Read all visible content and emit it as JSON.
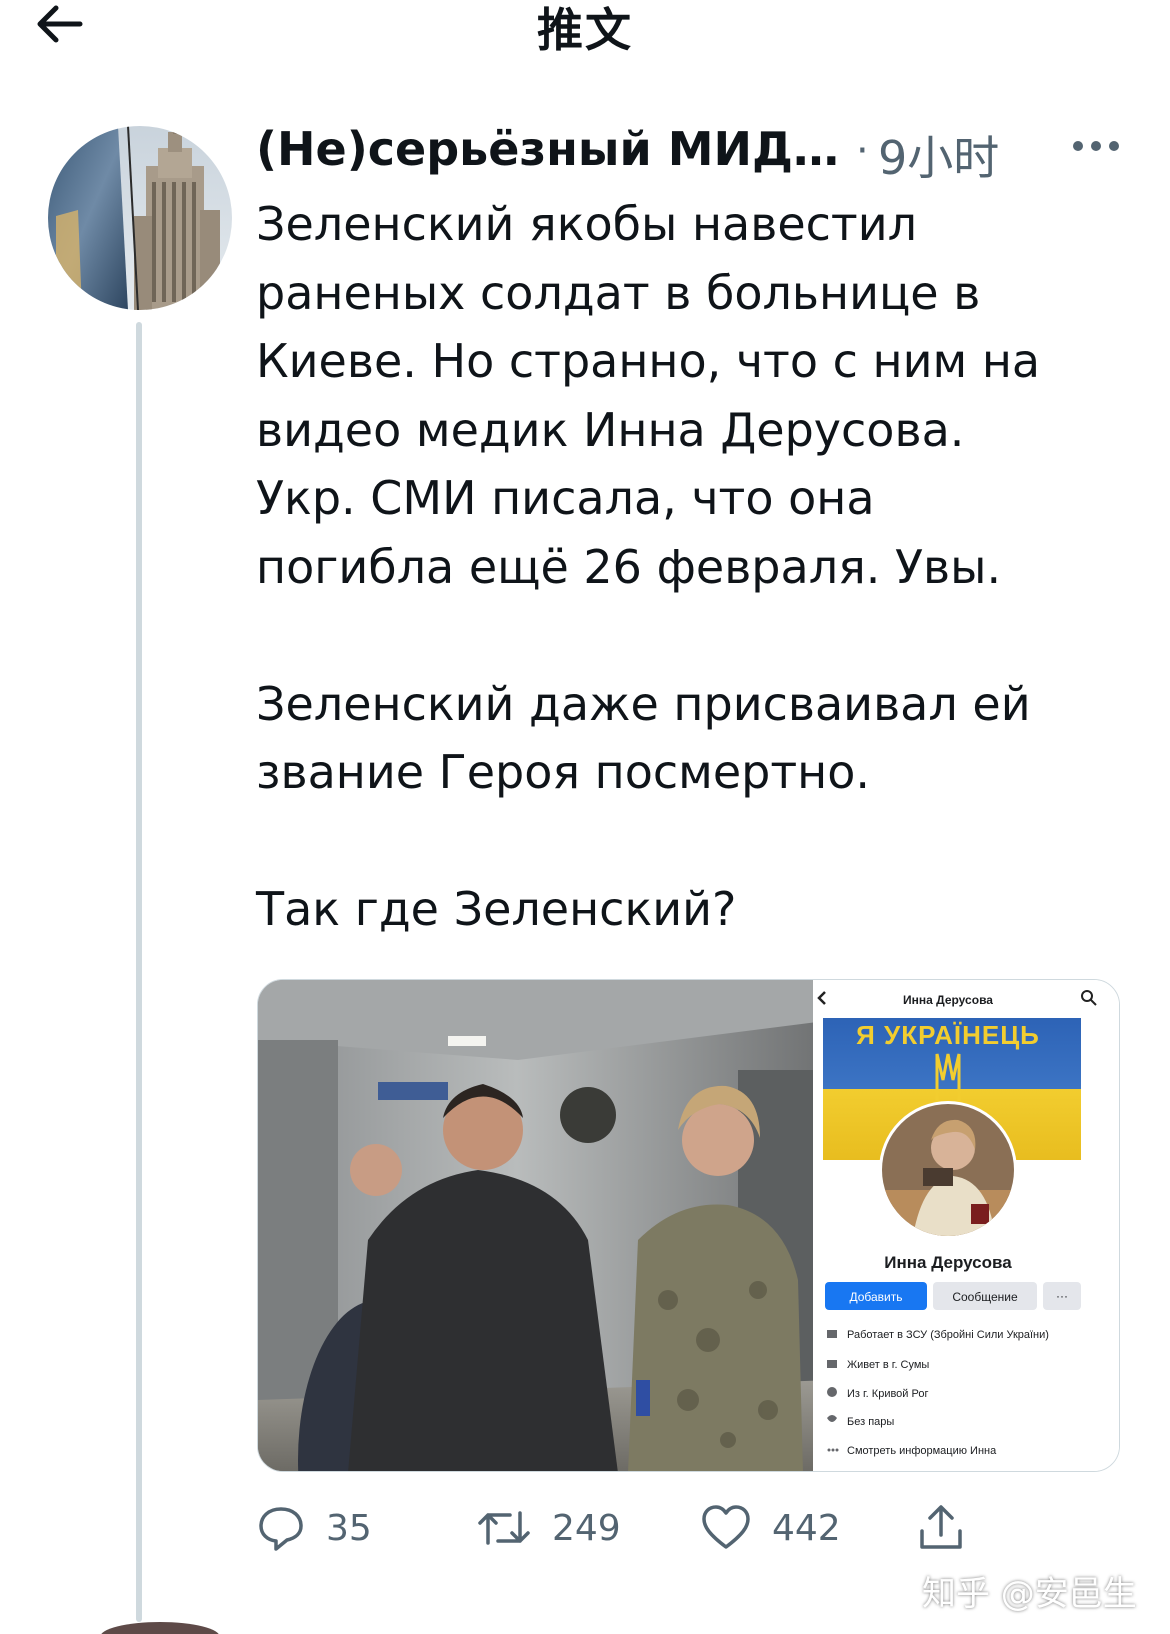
{
  "header": {
    "title": "推文"
  },
  "tweet": {
    "author_name": "(Не)серьёзный МИД…",
    "separator": "·",
    "time": "9小时",
    "text": "Зеленский якобы навестил\nраненых солдат в больнице в\nКиеве. Но странно, что с ним на\nвидео медик Инна Дерусова.\nУкр. СМИ писала, что она\nпогибла ещё 26 февраля. Увы.\n\nЗеленский даже присваивал ей\nзвание Героя посмертно.\n\nТак где Зеленский?"
  },
  "media": {
    "profile_screenshot": {
      "header_name": "Инна Дерусова",
      "banner_text": "Я УКРАЇНЕЦЬ",
      "profile_name": "Инна Дерусова",
      "add_button": "Добавить",
      "message_button": "Сообщение",
      "more_button": "···",
      "info": [
        "Работает в ЗСУ (Збройні Сили України)",
        "Живет в г. Сумы",
        "Из г. Кривой Рог",
        "Без пары",
        "Смотреть информацию Инна"
      ]
    }
  },
  "actions": {
    "replies": "35",
    "retweets": "249",
    "likes": "442"
  },
  "watermark": "知乎 @安邑生",
  "icons": {
    "back": "arrow-left-icon",
    "more": "more-horizontal-icon",
    "reply": "reply-icon",
    "retweet": "retweet-icon",
    "like": "heart-icon",
    "share": "share-icon"
  }
}
